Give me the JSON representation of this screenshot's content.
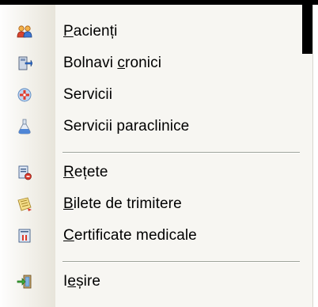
{
  "menu": {
    "items": [
      {
        "pre": "",
        "ul": "P",
        "post": "acienți",
        "icon": "patients-icon"
      },
      {
        "pre": "Bolnavi ",
        "ul": "c",
        "post": "ronici",
        "icon": "chronic-patients-icon"
      },
      {
        "pre": "Servicii",
        "ul": "",
        "post": "",
        "icon": "services-icon"
      },
      {
        "pre": "Servicii paraclinice",
        "ul": "",
        "post": "",
        "icon": "paraclinical-services-icon"
      },
      {
        "pre": "",
        "ul": "R",
        "post": "ețete",
        "icon": "prescriptions-icon"
      },
      {
        "pre": "",
        "ul": "B",
        "post": "ilete de trimitere",
        "icon": "referral-tickets-icon"
      },
      {
        "pre": "",
        "ul": "C",
        "post": "ertificate medicale",
        "icon": "medical-certificates-icon"
      },
      {
        "pre": "I",
        "ul": "e",
        "post": "șire",
        "icon": "exit-icon"
      }
    ]
  },
  "colors": {
    "menu_background": "#f7f6f2",
    "separator": "#9fa49b",
    "text": "#000000"
  }
}
